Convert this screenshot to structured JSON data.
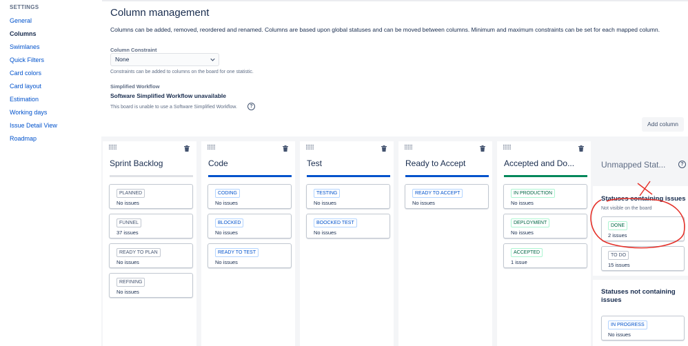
{
  "sidebar": {
    "heading": "SETTINGS",
    "items": [
      {
        "label": "General",
        "active": false
      },
      {
        "label": "Columns",
        "active": true
      },
      {
        "label": "Swimlanes",
        "active": false
      },
      {
        "label": "Quick Filters",
        "active": false
      },
      {
        "label": "Card colors",
        "active": false
      },
      {
        "label": "Card layout",
        "active": false
      },
      {
        "label": "Estimation",
        "active": false
      },
      {
        "label": "Working days",
        "active": false
      },
      {
        "label": "Issue Detail View",
        "active": false
      },
      {
        "label": "Roadmap",
        "active": false
      }
    ]
  },
  "header": {
    "title": "Column management",
    "description": "Columns can be added, removed, reordered and renamed. Columns are based upon global statuses and can be moved between columns. Minimum and maximum constraints can be set for each mapped column."
  },
  "constraint": {
    "label": "Column Constraint",
    "selected": "None",
    "helper": "Constraints can be added to columns on the board for one statistic."
  },
  "workflow": {
    "label": "Simplified Workflow",
    "title": "Software Simplified Workflow unavailable",
    "helper": "This board is unable to use a Software Simplified Workflow.",
    "help_icon": "?"
  },
  "add_column_label": "Add column",
  "colors": {
    "gray_bar": "#dfe1e6",
    "blue_bar": "#0052cc",
    "green_bar": "#00875a",
    "annotation_red": "#e5312a"
  },
  "columns": [
    {
      "title": "Sprint Backlog",
      "bar": "gray",
      "statuses": [
        {
          "name": "PLANNED",
          "count": "No issues",
          "tone": "gray"
        },
        {
          "name": "FUNNEL",
          "count": "37 issues",
          "tone": "gray"
        },
        {
          "name": "READY TO PLAN",
          "count": "No issues",
          "tone": "gray"
        },
        {
          "name": "REFINING",
          "count": "No issues",
          "tone": "gray"
        }
      ]
    },
    {
      "title": "Code",
      "bar": "blue",
      "statuses": [
        {
          "name": "CODING",
          "count": "No issues",
          "tone": "blue"
        },
        {
          "name": "BLOCKED",
          "count": "No issues",
          "tone": "blue"
        },
        {
          "name": "READY TO TEST",
          "count": "No issues",
          "tone": "blue"
        }
      ]
    },
    {
      "title": "Test",
      "bar": "blue",
      "statuses": [
        {
          "name": "TESTING",
          "count": "No issues",
          "tone": "blue"
        },
        {
          "name": "BOOCKED TEST",
          "count": "No issues",
          "tone": "blue"
        }
      ]
    },
    {
      "title": "Ready to Accept",
      "bar": "blue",
      "statuses": [
        {
          "name": "READY TO ACCEPT",
          "count": "No issues",
          "tone": "blue"
        }
      ]
    },
    {
      "title": "Accepted and Do...",
      "bar": "green",
      "statuses": [
        {
          "name": "IN PRODUCTION",
          "count": "No issues",
          "tone": "green"
        },
        {
          "name": "DEPLOYMENT",
          "count": "No issues",
          "tone": "green"
        },
        {
          "name": "ACCEPTED",
          "count": "1 issue",
          "tone": "green"
        }
      ]
    }
  ],
  "unmapped": {
    "title": "Unmapped Stat...",
    "help_icon": "?",
    "containing": {
      "title": "Statuses containing issues",
      "subtitle": "Not visible on the board",
      "statuses": [
        {
          "name": "DONE",
          "count": "2 issues",
          "tone": "green"
        },
        {
          "name": "TO DO",
          "count": "15 issues",
          "tone": "gray"
        }
      ]
    },
    "not_containing": {
      "title": "Statuses not containing issues",
      "statuses": [
        {
          "name": "IN PROGRESS",
          "count": "No issues",
          "tone": "blue"
        }
      ]
    }
  }
}
